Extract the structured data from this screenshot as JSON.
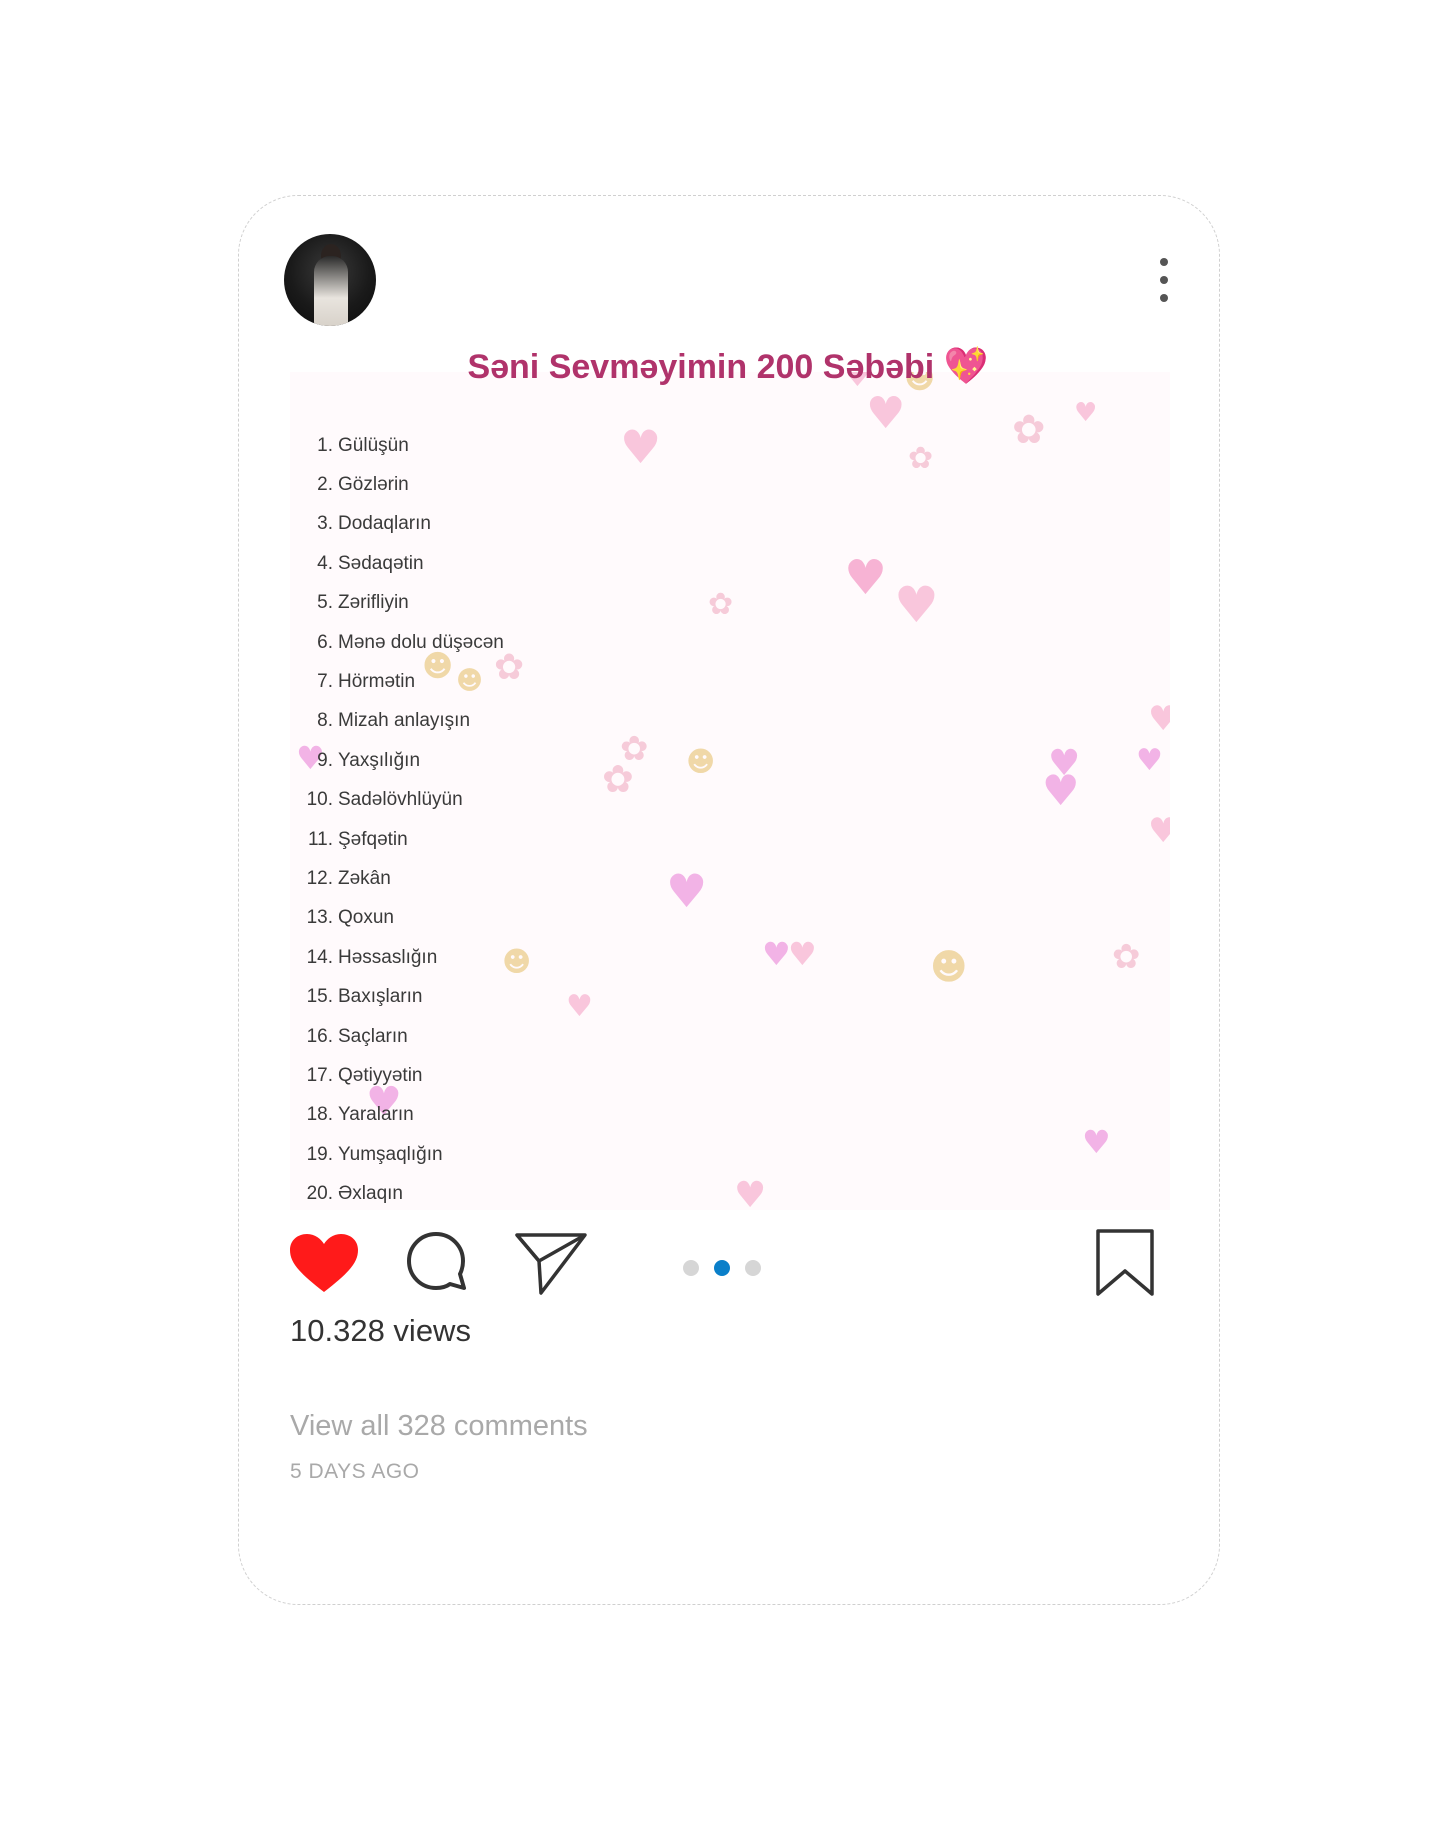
{
  "post": {
    "title": "Səni Sevməyimin 200 Səbəbi",
    "title_emoji": "💖",
    "reasons": [
      {
        "num": "1.",
        "text": "Gülüşün"
      },
      {
        "num": "2.",
        "text": "Gözlərin"
      },
      {
        "num": "3.",
        "text": "Dodaqların"
      },
      {
        "num": "4.",
        "text": "Sədaqətin"
      },
      {
        "num": "5.",
        "text": "Zərifliyin"
      },
      {
        "num": "6.",
        "text": "Mənə dolu düşəcən"
      },
      {
        "num": "7.",
        "text": "Hörmətin"
      },
      {
        "num": "8.",
        "text": "Mizah anlayışın"
      },
      {
        "num": "9.",
        "text": "Yaxşılığın"
      },
      {
        "num": "10.",
        "text": "Sadəlövhlüyün"
      },
      {
        "num": "11.",
        "text": "Şəfqətin"
      },
      {
        "num": "12.",
        "text": "Zəkân"
      },
      {
        "num": "13.",
        "text": "Qoxun"
      },
      {
        "num": "14.",
        "text": "Həssaslığın"
      },
      {
        "num": "15.",
        "text": "Baxışların"
      },
      {
        "num": "16.",
        "text": "Saçların"
      },
      {
        "num": "17.",
        "text": "Qətiyyətin"
      },
      {
        "num": "18.",
        "text": "Yaraların"
      },
      {
        "num": "19.",
        "text": "Yumşaqlığın"
      },
      {
        "num": "20.",
        "text": "Əxlaqın"
      }
    ],
    "views": "10.328 views",
    "comments_link": "View all 328 comments",
    "timestamp": "5 DAYS AGO"
  },
  "icons": {
    "like": "heart-icon",
    "comment": "comment-bubble-icon",
    "share": "paper-plane-icon",
    "save": "bookmark-icon",
    "more": "more-vertical-icon"
  },
  "carousel": {
    "total": 3,
    "active": 2
  },
  "colors": {
    "title": "#b0336b",
    "like": "#ff1a1a",
    "active_dot": "#0a7fc9",
    "inactive_dot": "#d6d6d6",
    "muted_text": "#a9a9a9"
  }
}
